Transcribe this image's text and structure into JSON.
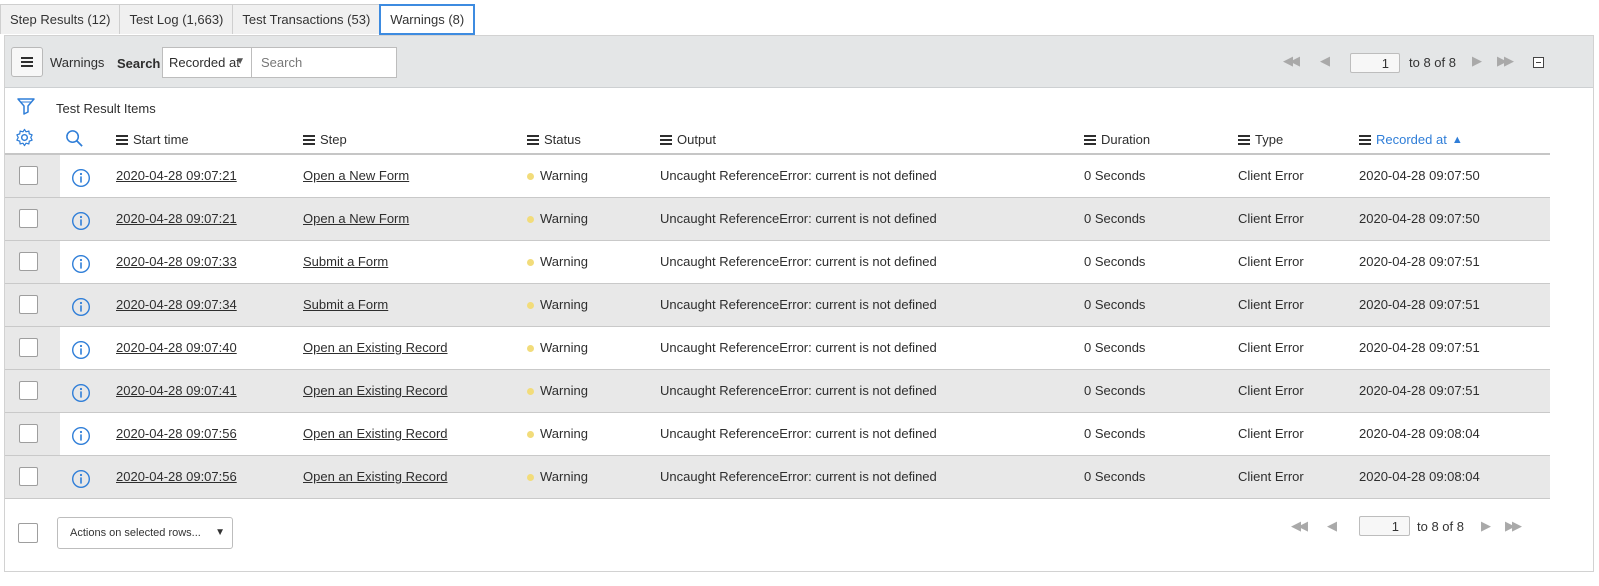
{
  "tabs": [
    {
      "label": "Step Results (12)"
    },
    {
      "label": "Test Log (1,663)"
    },
    {
      "label": "Test Transactions (53)"
    },
    {
      "label": "Warnings (8)"
    }
  ],
  "toolbar": {
    "title": "Warnings",
    "search_label": "Search",
    "search_field": "Recorded at",
    "search_placeholder": "Search",
    "page_value": "1",
    "page_range": "to 8 of 8"
  },
  "breadcrumb": {
    "text": "Test Result Items"
  },
  "columns": {
    "start_time": "Start time",
    "step": "Step",
    "status": "Status",
    "output": "Output",
    "duration": "Duration",
    "type": "Type",
    "recorded_at": "Recorded at",
    "sort_arrow": "▲"
  },
  "rows": [
    {
      "start": "2020-04-28 09:07:21",
      "step": "Open a New Form",
      "status": "Warning",
      "output": "Uncaught ReferenceError: current is not defined",
      "duration": "0 Seconds",
      "type": "Client Error",
      "recorded": "2020-04-28 09:07:50"
    },
    {
      "start": "2020-04-28 09:07:21",
      "step": "Open a New Form",
      "status": "Warning",
      "output": "Uncaught ReferenceError: current is not defined",
      "duration": "0 Seconds",
      "type": "Client Error",
      "recorded": "2020-04-28 09:07:50"
    },
    {
      "start": "2020-04-28 09:07:33",
      "step": "Submit a Form",
      "status": "Warning",
      "output": "Uncaught ReferenceError: current is not defined",
      "duration": "0 Seconds",
      "type": "Client Error",
      "recorded": "2020-04-28 09:07:51"
    },
    {
      "start": "2020-04-28 09:07:34",
      "step": "Submit a Form",
      "status": "Warning",
      "output": "Uncaught ReferenceError: current is not defined",
      "duration": "0 Seconds",
      "type": "Client Error",
      "recorded": "2020-04-28 09:07:51"
    },
    {
      "start": "2020-04-28 09:07:40",
      "step": "Open an Existing Record",
      "status": "Warning",
      "output": "Uncaught ReferenceError: current is not defined",
      "duration": "0 Seconds",
      "type": "Client Error",
      "recorded": "2020-04-28 09:07:51"
    },
    {
      "start": "2020-04-28 09:07:41",
      "step": "Open an Existing Record",
      "status": "Warning",
      "output": "Uncaught ReferenceError: current is not defined",
      "duration": "0 Seconds",
      "type": "Client Error",
      "recorded": "2020-04-28 09:07:51"
    },
    {
      "start": "2020-04-28 09:07:56",
      "step": "Open an Existing Record",
      "status": "Warning",
      "output": "Uncaught ReferenceError: current is not defined",
      "duration": "0 Seconds",
      "type": "Client Error",
      "recorded": "2020-04-28 09:08:04"
    },
    {
      "start": "2020-04-28 09:07:56",
      "step": "Open an Existing Record",
      "status": "Warning",
      "output": "Uncaught ReferenceError: current is not defined",
      "duration": "0 Seconds",
      "type": "Client Error",
      "recorded": "2020-04-28 09:08:04"
    }
  ],
  "footer": {
    "actions_label": "Actions on selected rows...",
    "page_value": "1",
    "page_range": "to 8 of 8"
  },
  "colors": {
    "accent": "#2f7ed8",
    "warning_dot": "#f2dc7a",
    "toolbar_bg": "#e4e6e7"
  },
  "icons": [
    "menu-icon",
    "filter-icon",
    "gear-icon",
    "search-icon",
    "info-icon",
    "first-page-icon",
    "prev-page-icon",
    "next-page-icon",
    "last-page-icon",
    "collapse-icon"
  ]
}
